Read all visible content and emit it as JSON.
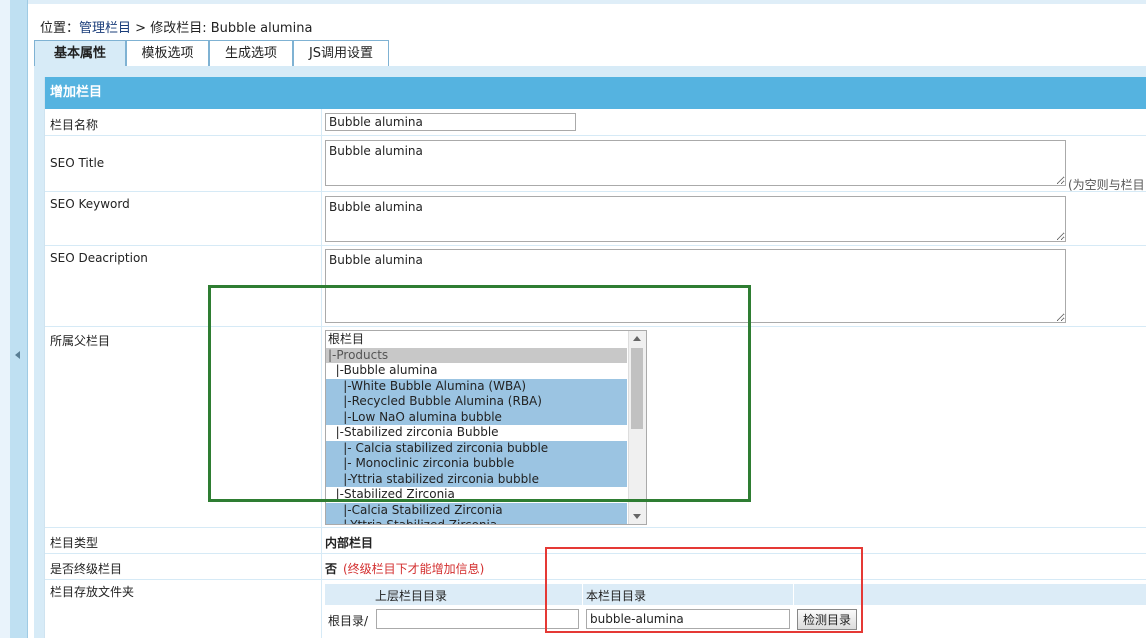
{
  "breadcrumb": {
    "prefix": "位置：",
    "link": "管理栏目",
    "separator": " > ",
    "current": "修改栏目: Bubble alumina"
  },
  "tabs": [
    {
      "label": "基本属性",
      "active": true
    },
    {
      "label": "模板选项",
      "active": false
    },
    {
      "label": "生成选项",
      "active": false
    },
    {
      "label": "JS调用设置",
      "active": false
    }
  ],
  "panel": {
    "title": "增加栏目"
  },
  "form": {
    "name_label": "栏目名称",
    "name_value": "Bubble alumina",
    "seo_title_label": "SEO Title",
    "seo_title_value": "Bubble alumina",
    "seo_title_hint": "(为空则与栏目",
    "seo_keyword_label": "SEO Keyword",
    "seo_keyword_value": "Bubble alumina",
    "seo_desc_label": "SEO Deacription",
    "seo_desc_value": "Bubble alumina",
    "parent_label": "所属父栏目",
    "parent_options": [
      {
        "text": "根栏目",
        "state": "normal"
      },
      {
        "text": "|-Products",
        "state": "disabled"
      },
      {
        "text": "  |-Bubble alumina",
        "state": "normal"
      },
      {
        "text": "    |-White Bubble Alumina (WBA)",
        "state": "selected"
      },
      {
        "text": "    |-Recycled Bubble Alumina (RBA)",
        "state": "selected"
      },
      {
        "text": "    |-Low NaO alumina bubble",
        "state": "selected"
      },
      {
        "text": "  |-Stabilized zirconia Bubble",
        "state": "normal"
      },
      {
        "text": "    |- Calcia stabilized zirconia bubble",
        "state": "selected"
      },
      {
        "text": "    |- Monoclinic zirconia bubble",
        "state": "selected"
      },
      {
        "text": "    |-Yttria stabilized zirconia bubble",
        "state": "selected"
      },
      {
        "text": "  |-Stabilized Zirconia",
        "state": "normal"
      },
      {
        "text": "    |-Calcia Stabilized Zirconia",
        "state": "selected"
      },
      {
        "text": "    |-Yttria Stabilized Zirconia",
        "state": "selected"
      }
    ],
    "type_label": "栏目类型",
    "type_value": "内部栏目",
    "final_label": "是否终级栏目",
    "final_value": "否",
    "final_note": "(终级栏目下才能增加信息)",
    "folder_label": "栏目存放文件夹",
    "folder_parent_header": "上层栏目目录",
    "folder_own_header": "本栏目目录",
    "folder_root_prefix": "根目录/",
    "folder_parent_value": "",
    "folder_own_value": "bubble-alumina",
    "check_button": "检测目录"
  },
  "colors": {
    "header_bg": "#55b3e0",
    "annotation_green": "#2e7d32",
    "annotation_red": "#e53935",
    "note_red": "#d32f2f"
  }
}
